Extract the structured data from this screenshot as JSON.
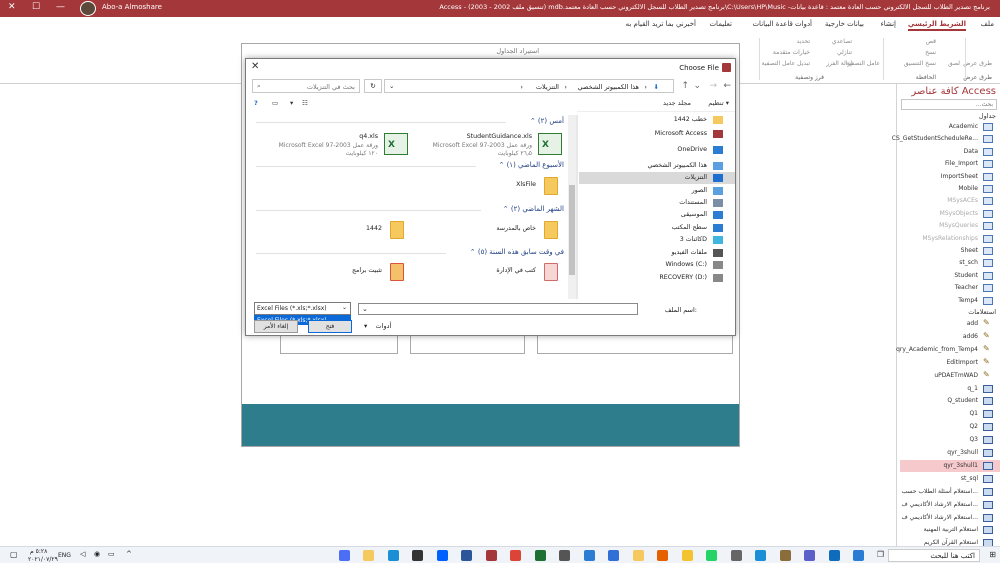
{
  "window": {
    "title": "برنامج تصدير الطلاب للسجل الالكتروني حسب العادة معتمد : قاعدة بيانات- C:\\Users\\HP\\Music\\برنامج تصدير الطلاب للسجل الالكتروني حسب العادة معتمد.mdb (تنسيق ملف 2002 - 2003)  - Access",
    "user": "Abo-a Almoshare",
    "min": "—",
    "max": "☐",
    "close": "✕"
  },
  "ribbon": {
    "tabs": [
      "ملف",
      "الشريط الرئيسي",
      "إنشاء",
      "بيانات خارجية",
      "أدوات قاعدة البيانات",
      "تعليمات",
      "أخبرني بما تريد القيام به"
    ],
    "active_tab": "الشريط الرئيسي",
    "items": [
      "طرق عرض",
      "لصق",
      "قص",
      "نسخ",
      "نسخ التنسيق",
      "عامل التصفية",
      "تصاعدي",
      "تنازلي",
      "إزالة الفرز",
      "تحديد",
      "خيارات متقدمة",
      "تبديل عامل التصفية"
    ],
    "groups": [
      "طرق عرض",
      "الحافظة",
      "فرز وتصفية"
    ]
  },
  "nav": {
    "header": "كافة عناصر Access",
    "search_placeholder": "بحث...",
    "section_tables": "جداول",
    "section_queries": "استعلامات",
    "tables": [
      {
        "name": "Academic",
        "gray": false
      },
      {
        "name": "CS_GetStudentScheduleRe...",
        "gray": false
      },
      {
        "name": "Data",
        "gray": false
      },
      {
        "name": "File_Import",
        "gray": false
      },
      {
        "name": "ImportSheet",
        "gray": false
      },
      {
        "name": "Mobile",
        "gray": false
      },
      {
        "name": "MSysACEs",
        "gray": true
      },
      {
        "name": "MSysObjects",
        "gray": true
      },
      {
        "name": "MSysQueries",
        "gray": true
      },
      {
        "name": "MSysRelationships",
        "gray": true
      },
      {
        "name": "Sheet",
        "gray": false
      },
      {
        "name": "st_sch",
        "gray": false
      },
      {
        "name": "Student",
        "gray": false
      },
      {
        "name": "Teacher",
        "gray": false
      },
      {
        "name": "Temp4",
        "gray": false
      }
    ],
    "queries": [
      {
        "name": "add",
        "kind": "action"
      },
      {
        "name": "add6",
        "kind": "action"
      },
      {
        "name": "qry_Academic_from_Temp4",
        "kind": "action"
      },
      {
        "name": "EditImport",
        "kind": "action"
      },
      {
        "name": "uPDAETmWAD",
        "kind": "action"
      },
      {
        "name": "q_1",
        "kind": "select"
      },
      {
        "name": "Q_student",
        "kind": "select"
      },
      {
        "name": "Q1",
        "kind": "select"
      },
      {
        "name": "Q2",
        "kind": "select"
      },
      {
        "name": "Q3",
        "kind": "select"
      },
      {
        "name": "qyr_3shull",
        "kind": "select"
      },
      {
        "name": "qyr_3shull1",
        "kind": "select",
        "selected": true
      },
      {
        "name": "st_sql",
        "kind": "select"
      },
      {
        "name": "استعلام أسئلة الطلاب حسب...",
        "kind": "select"
      },
      {
        "name": "استعلام الارشاد الأكاديمي ف...",
        "kind": "select"
      },
      {
        "name": "استعلام الارشاد الأكاديمي ف...",
        "kind": "select"
      },
      {
        "name": "استعلام التربية المهنية",
        "kind": "select"
      },
      {
        "name": "استعلام القرآن الكريم",
        "kind": "select"
      }
    ]
  },
  "import_dialog": {
    "title": "استيراد الجداول"
  },
  "file_dialog": {
    "title": "Choose File",
    "path": [
      "هذا الكمبيوتر الشخصي",
      "التنزيلات"
    ],
    "search_placeholder": "بحث في التنزيلات",
    "organize": "تنظيم",
    "new_folder": "مجلد جديد",
    "tree": [
      {
        "label": "خطب 1442",
        "icon": "folder"
      },
      {
        "label": "Microsoft Access",
        "icon": "access"
      },
      {
        "label": "OneDrive",
        "icon": "cloud"
      },
      {
        "label": "هذا الكمبيوتر الشخصي",
        "icon": "pc"
      },
      {
        "label": "التنزيلات",
        "icon": "download",
        "selected": true
      },
      {
        "label": "الصور",
        "icon": "pictures"
      },
      {
        "label": "المستندات",
        "icon": "docs"
      },
      {
        "label": "الموسيقى",
        "icon": "music"
      },
      {
        "label": "سطح المكتب",
        "icon": "desktop"
      },
      {
        "label": "كائنات 3D",
        "icon": "3d"
      },
      {
        "label": "ملفات الفيديو",
        "icon": "video"
      },
      {
        "label": "Windows (C:)",
        "icon": "drive"
      },
      {
        "label": "RECOVERY (D:)",
        "icon": "drive"
      }
    ],
    "groups": [
      "أمس (٢)",
      "الأسبوع الماضي (١)",
      "الشهر الماضي (٢)",
      "في وقت سابق هذه السنة (٥)"
    ],
    "files": [
      {
        "name": "StudentGuidance.xls",
        "type": "Microsoft Excel 97-2003 ورقة عمل",
        "size": "٢٦٫٥ كيلوبايت",
        "icon": "xls"
      },
      {
        "name": "q4.xls",
        "type": "Microsoft Excel 97-2003 ورقة عمل",
        "size": "١٢٠ كيلوبايت",
        "icon": "xls"
      },
      {
        "name": "XlsFile",
        "icon": "folder"
      },
      {
        "name": "خاص بالمدرسة",
        "icon": "folder"
      },
      {
        "name": "1442",
        "icon": "folder"
      },
      {
        "name": "كتب في الإدارة",
        "icon": "folder-red"
      },
      {
        "name": "تثبيت برامج",
        "icon": "folder-red"
      }
    ],
    "filename_label": "اسم الملف:",
    "filename_value": "",
    "filetype_value": "Excel Files (*.xls;*.xlsx)",
    "filetype_option": "Excel Files (*.xls;*.xlsx)",
    "tools": "أدوات",
    "open_button": "فتح",
    "cancel_button": "إلغاء الأمر"
  },
  "taskbar": {
    "search_placeholder": "اكتب هنا للبحث",
    "time": "٥:٢٨ م",
    "date": "٢٠٢١/٠٧/٢٩",
    "lang": "ENG"
  },
  "colors": {
    "access_red": "#a4373a",
    "teal": "#2e7d8c",
    "select_blue": "#0c6ad8"
  }
}
